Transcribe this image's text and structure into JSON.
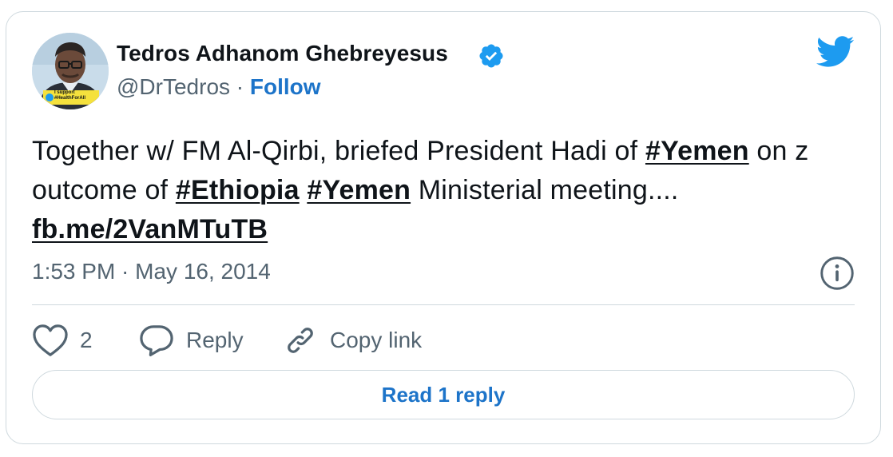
{
  "author": {
    "name": "Tedros Adhanom Ghebreyesus",
    "handle": "@DrTedros",
    "separator": "·",
    "follow_label": "Follow",
    "avatar_badge_text": [
      "I support",
      "#HealthForAll"
    ]
  },
  "tweet": {
    "segments": [
      {
        "text": "Together w/ FM Al-Qirbi, briefed President Hadi of ",
        "link": false
      },
      {
        "text": "#Yemen",
        "link": true
      },
      {
        "text": " on z outcome of ",
        "link": false
      },
      {
        "text": "#Ethiopia",
        "link": true
      },
      {
        "text": " ",
        "link": false
      },
      {
        "text": "#Yemen",
        "link": true
      },
      {
        "text": " Ministerial meeting.... ",
        "link": false
      },
      {
        "text": "fb.me/2VanMTuTB",
        "link": true
      }
    ],
    "timestamp": "1:53 PM · May 16, 2014"
  },
  "actions": {
    "like_count": "2",
    "reply_label": "Reply",
    "copy_link_label": "Copy link",
    "read_reply_label": "Read 1 reply"
  },
  "icons": {
    "verified": "verified-badge-icon",
    "bird": "twitter-bird-icon",
    "info": "info-icon",
    "like": "heart-icon",
    "reply": "speech-bubble-icon",
    "copy": "link-icon"
  },
  "colors": {
    "accent": "#1d9bf0",
    "link_text": "#1d74c9",
    "muted_text": "#536471",
    "border": "#cfd9de",
    "badge_yellow": "#f5e13d"
  }
}
